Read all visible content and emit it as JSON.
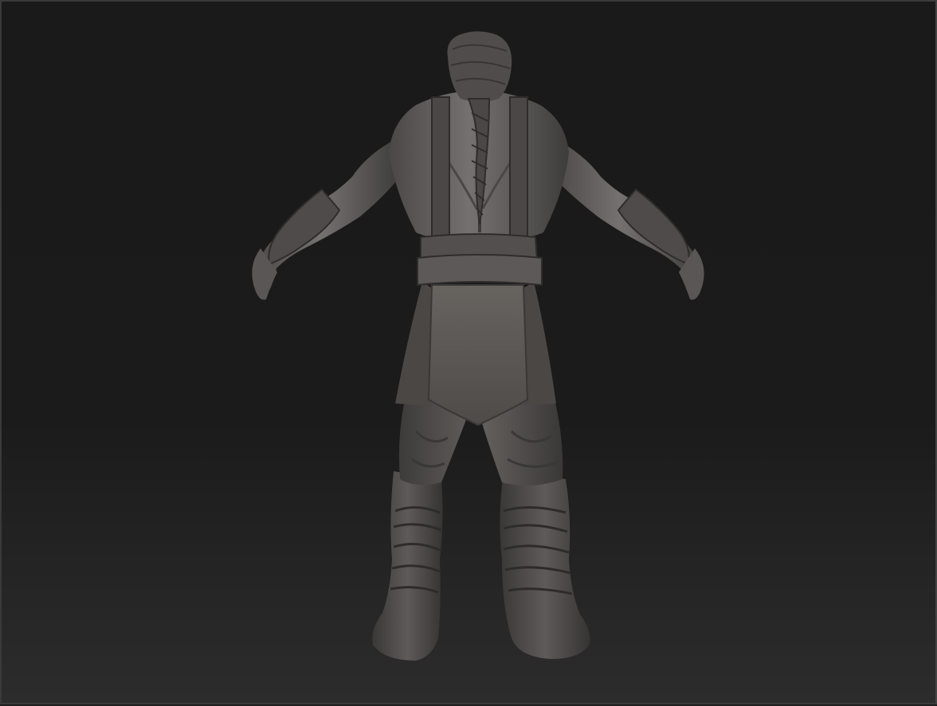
{
  "viewport": {
    "background_top": "#1a1a1a",
    "background_bottom": "#2c2c2c",
    "border_color": "#3a3a3a"
  },
  "model": {
    "material_light": "#6e6a68",
    "material_mid": "#545150",
    "material_dark": "#2f2d2c",
    "view": "back"
  }
}
